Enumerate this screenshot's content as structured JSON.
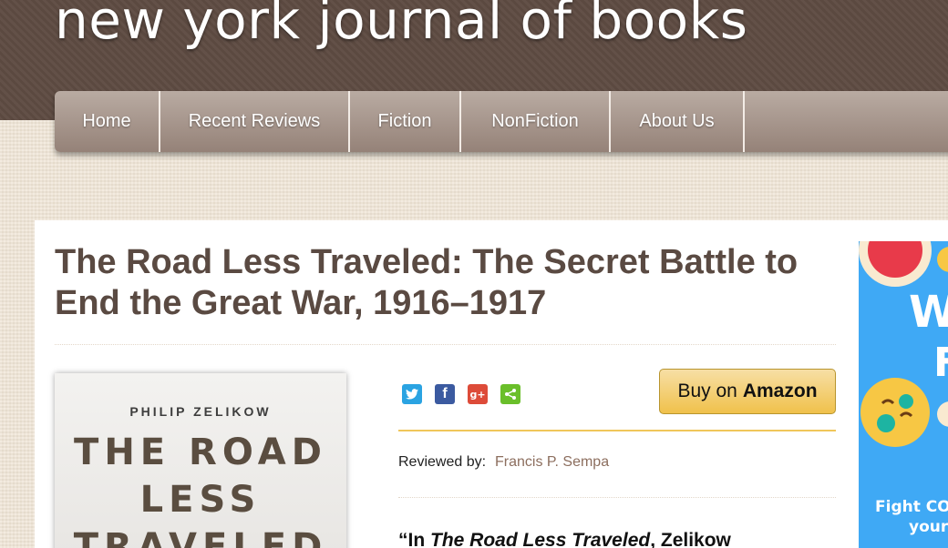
{
  "site": {
    "title": "new york journal of books"
  },
  "nav": {
    "items": [
      {
        "label": "Home"
      },
      {
        "label": "Recent Reviews"
      },
      {
        "label": "Fiction"
      },
      {
        "label": "NonFiction"
      },
      {
        "label": "About Us"
      }
    ]
  },
  "article": {
    "title": "The Road Less Traveled: The Secret Battle to End the Great War, 1916–1917",
    "reviewed_by_label": "Reviewed by:",
    "reviewer": "Francis P. Sempa",
    "quote_open": "“In ",
    "quote_title": "The Road Less Traveled",
    "quote_rest": ", Zelikow"
  },
  "cover": {
    "author": "PHILIP ZELIKOW",
    "line1": "THE ROAD",
    "line2": "LESS",
    "line3": "TRAVELED"
  },
  "share": {
    "icons": [
      {
        "name": "twitter-icon",
        "glyph": "t",
        "color": "#2aa3e2"
      },
      {
        "name": "facebook-icon",
        "glyph": "f",
        "color": "#3b5aa0"
      },
      {
        "name": "google-plus-icon",
        "glyph": "g+",
        "color": "#dd4b39"
      },
      {
        "name": "share-icon",
        "glyph": "<",
        "color": "#6abf2a"
      }
    ]
  },
  "buy": {
    "prefix": "Buy on",
    "brand": "Amazon"
  },
  "ad": {
    "line1": "W",
    "line2": "F",
    "line3": "Fight COV",
    "line4": "your"
  }
}
